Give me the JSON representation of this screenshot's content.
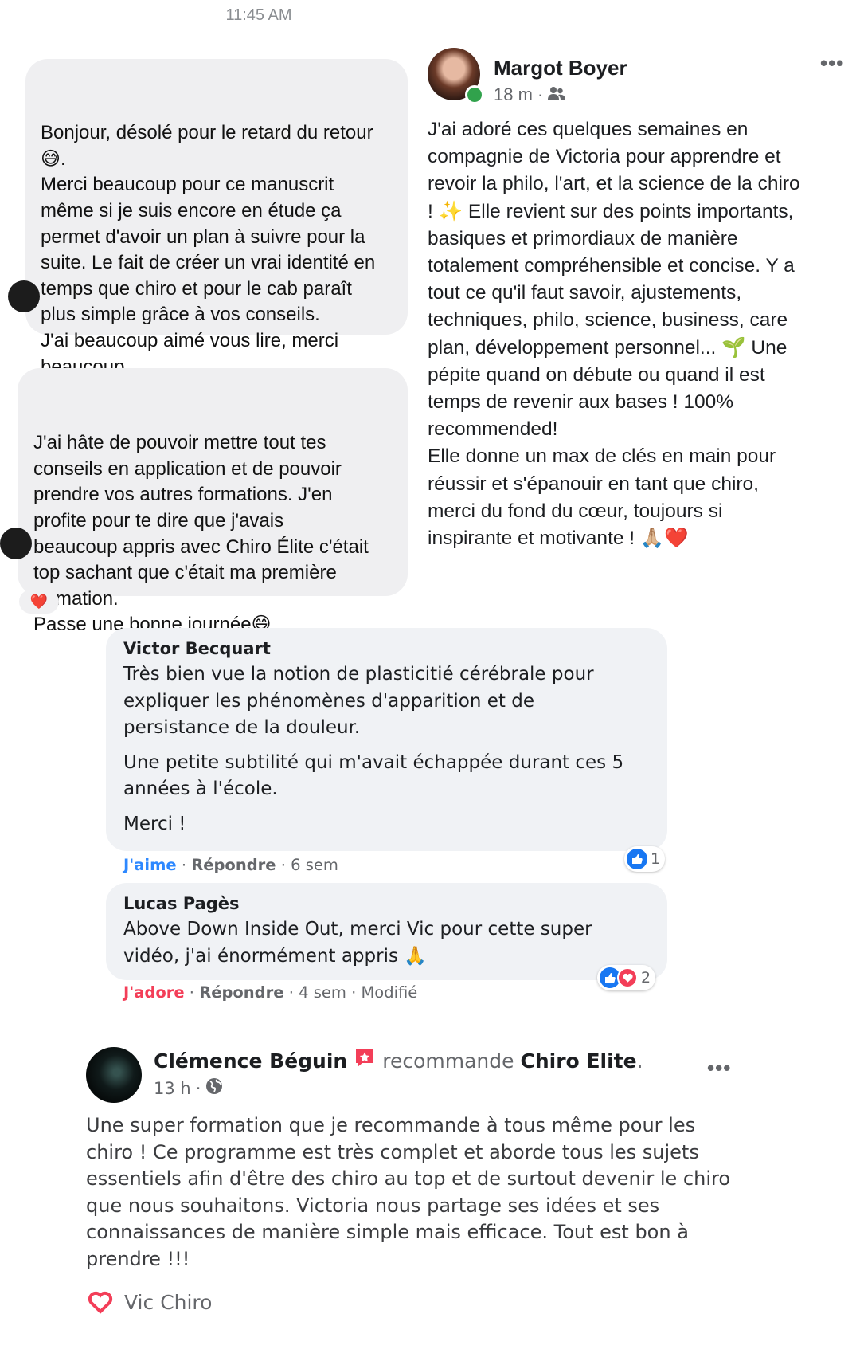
{
  "messenger": {
    "time": "11:45 AM",
    "message1": "Bonjour, désolé pour le retard du retour\n😅.\nMerci beaucoup pour ce manuscrit\nmême si je suis encore en étude ça\npermet d'avoir un plan à suivre pour la\nsuite. Le fait de créer un vrai identité en\ntemps que chiro et pour le cab paraît\nplus simple grâce à vos conseils.\nJ'ai beaucoup aimé vous lire, merci\nbeaucoup",
    "message2": "J'ai hâte de pouvoir mettre tout tes\nconseils en application et de pouvoir\nprendre vos autres formations. J'en\nprofite pour te dire que j'avais\nbeaucoup appris avec Chiro Élite c'était\ntop sachant que c'était ma première\nformation.\nPasse une bonne journée😄",
    "reaction": "❤️"
  },
  "margot_post": {
    "author": "Margot Boyer",
    "time": "18 m",
    "separator": "·",
    "more": "•••",
    "text": "J'ai adoré ces quelques semaines en\ncompagnie de Victoria pour apprendre et\nrevoir la philo, l'art, et la science de la chiro\n! ✨ Elle revient sur des points importants,\nbasiques et primordiaux de manière\ntotalement compréhensible et concise. Y a\ntout ce qu'il faut savoir, ajustements,\ntechniques, philo, science, business, care\nplan, développement personnel... 🌱 Une\npépite quand on débute ou quand il est\ntemps de revenir aux bases ! 100%\nrecommended!\nElle donne un max de clés en main pour\nréussir et s'épanouir en tant que chiro,\nmerci du fond du cœur, toujours si\ninspirante et motivante ! 🙏🏼❤️"
  },
  "comments": [
    {
      "author": "Victor Becquart",
      "paragraphs": [
        "Très bien vue la notion de plasticitié cérébrale pour\nexpliquer les phénomènes d'apparition et de\npersistance de la douleur.",
        "Une petite subtilité qui m'avait échappée durant ces 5\nannées à l'école.",
        "Merci !"
      ],
      "reaction_action": "J'aime",
      "reply": "Répondre",
      "time": "6 sem",
      "reaction_count": "1"
    },
    {
      "author": "Lucas Pagès",
      "paragraphs": [
        "Above Down Inside Out, merci Vic pour cette super\nvidéo, j'ai énormément appris 🙏"
      ],
      "reaction_action": "J'adore",
      "reply": "Répondre",
      "time": "4 sem",
      "edited": "Modifié",
      "reaction_count": "2"
    }
  ],
  "recommendation_post": {
    "author": "Clémence Béguin",
    "verb": "recommande",
    "page": "Chiro Elite",
    "period": ".",
    "time": "13 h",
    "separator": "·",
    "more": "•••",
    "text": "Une super formation que je recommande à tous même pour les\nchiro ! Ce programme est très complet et aborde tous les sujets\nessentiels afin d'être des chiro au top et de surtout devenir le chiro\nque nous souhaitons. Victoria nous partage ses idées et ses\nconnaissances de manière simple mais efficace. Tout est bon à\nprendre !!!",
    "footer_name": "Vic Chiro"
  },
  "colors": {
    "like_blue": "#2d88ff",
    "love_red": "#f33e58",
    "online_green": "#31a24c",
    "bubble_grey": "#efeff1"
  }
}
